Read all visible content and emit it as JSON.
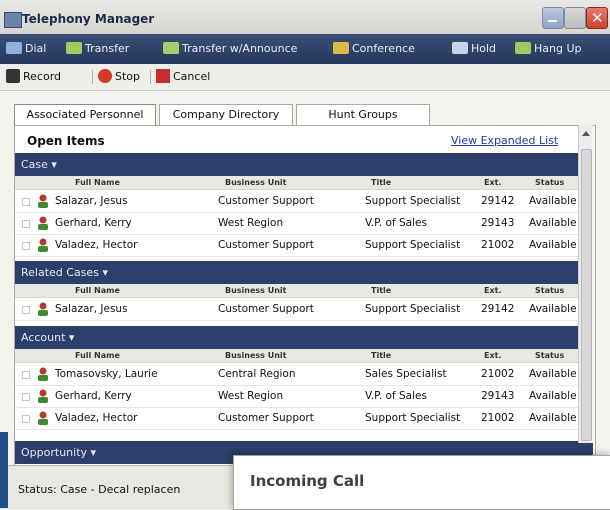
{
  "window": {
    "title": "Telephony Manager"
  },
  "toolbar": {
    "buttons": [
      {
        "label": "Dial"
      },
      {
        "label": "Transfer"
      },
      {
        "label": "Transfer w/Announce"
      },
      {
        "label": "Conference"
      },
      {
        "label": "Hold"
      },
      {
        "label": "Hang Up"
      }
    ],
    "secondary": [
      {
        "label": "Record"
      },
      {
        "label": "Stop"
      },
      {
        "label": "Cancel"
      }
    ]
  },
  "tabs": [
    {
      "label": "Associated Personnel",
      "active": true
    },
    {
      "label": "Company Directory",
      "active": false
    },
    {
      "label": "Hunt Groups",
      "active": false
    }
  ],
  "panel": {
    "heading": "Open Items",
    "link": "View Expanded List",
    "columns": [
      "Full Name",
      "Business Unit",
      "Title",
      "Ext.",
      "Status"
    ],
    "sections": [
      {
        "label": "Case",
        "rows": [
          [
            "Salazar, Jesus",
            "Customer Support",
            "Support Specialist",
            "29142",
            "Available"
          ],
          [
            "Gerhard, Kerry",
            "West Region",
            "V.P. of Sales",
            "29143",
            "Available"
          ],
          [
            "Valadez, Hector",
            "Customer Support",
            "Support Specialist",
            "21002",
            "Available"
          ]
        ]
      },
      {
        "label": "Related Cases",
        "rows": [
          [
            "Salazar, Jesus",
            "Customer Support",
            "Support Specialist",
            "29142",
            "Available"
          ]
        ]
      },
      {
        "label": "Account",
        "rows": [
          [
            "Tomasovsky, Laurie",
            "Central Region",
            "Sales Specialist",
            "21002",
            "Available"
          ],
          [
            "Gerhard, Kerry",
            "West Region",
            "V.P. of Sales",
            "29143",
            "Available"
          ],
          [
            "Valadez, Hector",
            "Customer Support",
            "Support Specialist",
            "21002",
            "Available"
          ]
        ]
      },
      {
        "label": "Opportunity",
        "rows": []
      }
    ]
  },
  "statusbar": {
    "text": "Status:  Case - Decal replacen"
  },
  "incoming_call": {
    "title": "Incoming Call"
  },
  "colors": {
    "toolbar": "#2c3e69",
    "section_header": "#2c3e69",
    "link": "#1d3fa5"
  }
}
